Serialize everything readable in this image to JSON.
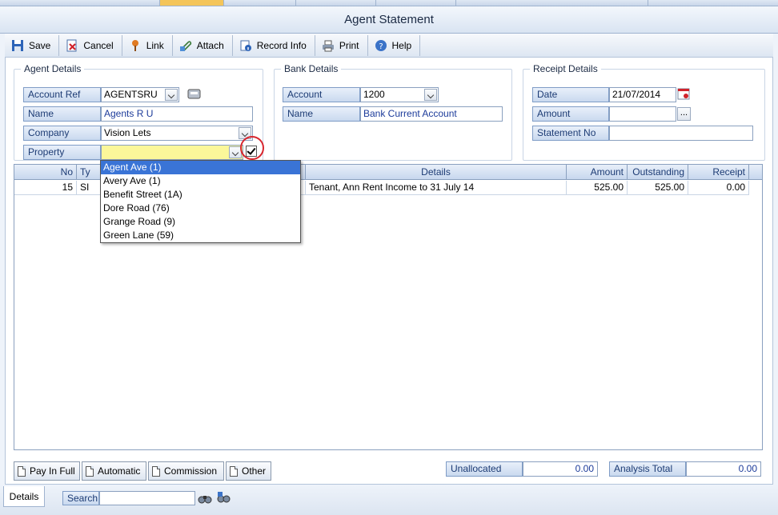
{
  "window": {
    "title": "Agent Statement"
  },
  "toolbar": {
    "save": "Save",
    "cancel": "Cancel",
    "link": "Link",
    "attach": "Attach",
    "record_info": "Record Info",
    "print": "Print",
    "help": "Help"
  },
  "agent": {
    "legend": "Agent Details",
    "account_ref_label": "Account Ref",
    "account_ref": "AGENTSRU",
    "name_label": "Name",
    "name": "Agents R U",
    "company_label": "Company",
    "company": "Vision Lets",
    "property_label": "Property",
    "property": ""
  },
  "bank": {
    "legend": "Bank Details",
    "account_label": "Account",
    "account": "1200",
    "name_label": "Name",
    "name": "Bank Current Account"
  },
  "receipt": {
    "legend": "Receipt Details",
    "date_label": "Date",
    "date": "21/07/2014",
    "amount_label": "Amount",
    "amount": "",
    "statement_no_label": "Statement No",
    "statement_no": "",
    "amount_btn": "..."
  },
  "grid": {
    "columns": {
      "no": "No",
      "type": "Ty",
      "details": "Details",
      "amount": "Amount",
      "outstanding": "Outstanding",
      "receipt": "Receipt"
    },
    "rows": [
      {
        "no": "15",
        "type": "SI",
        "details": "Tenant, Ann Rent Income to 31 July 14",
        "amount": "525.00",
        "outstanding": "525.00",
        "receipt": "0.00"
      }
    ]
  },
  "property_dropdown": {
    "options": [
      "Agent Ave (1)",
      "Avery Ave (1)",
      "Benefit Street (1A)",
      "Dore Road (76)",
      "Grange Road (9)",
      "Green Lane (59)"
    ]
  },
  "actions": {
    "pay_in_full": "Pay In Full",
    "automatic": "Automatic",
    "commission": "Commission",
    "other": "Other"
  },
  "totals": {
    "unallocated_label": "Unallocated",
    "unallocated": "0.00",
    "analysis_total_label": "Analysis Total",
    "analysis_total": "0.00"
  },
  "footer": {
    "details_tab": "Details",
    "search_label": "Search",
    "search_value": ""
  }
}
